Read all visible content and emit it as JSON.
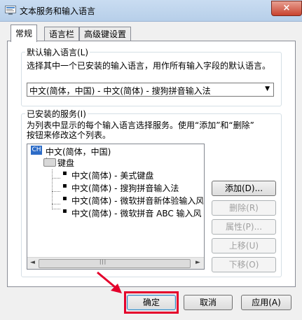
{
  "window": {
    "title": "文本服务和输入语言",
    "close_glyph": "×"
  },
  "tabs": [
    {
      "label": "常规",
      "active": true
    },
    {
      "label": "语言栏",
      "active": false
    },
    {
      "label": "高级键设置",
      "active": false
    }
  ],
  "default_language": {
    "legend": "默认输入语言(L)",
    "description": "选择其中一个已安装的输入语言，用作所有输入字段的默认语言。",
    "selected": "中文(简体，中国) - 中文(简体) - 搜狗拼音输入法"
  },
  "installed_services": {
    "legend": "已安装的服务(I)",
    "description_line1": "为列表中显示的每个输入语言选择服务。使用“添加”和“删除”",
    "description_line2": "按钮来修改这个列表。",
    "language_badge": "CH",
    "language_label": "中文(简体，中国)",
    "category_label": "键盘",
    "items": [
      "中文(简体) - 美式键盘",
      "中文(简体) - 搜狗拼音输入法",
      "中文(简体) - 微软拼音新体验输入风",
      "中文(简体) - 微软拼音 ABC 输入风"
    ],
    "scroll_left": "◄",
    "scroll_right": "►",
    "scroll_grip": "|||"
  },
  "side_buttons": {
    "add": "添加(D)...",
    "remove": "删除(R)",
    "properties": "属性(P)...",
    "move_up": "上移(U)",
    "move_down": "下移(O)"
  },
  "footer_buttons": {
    "ok": "确定",
    "cancel": "取消",
    "apply": "应用(A)"
  },
  "colors": {
    "highlight": "#e4002b",
    "accent": "#2d6cc7"
  }
}
